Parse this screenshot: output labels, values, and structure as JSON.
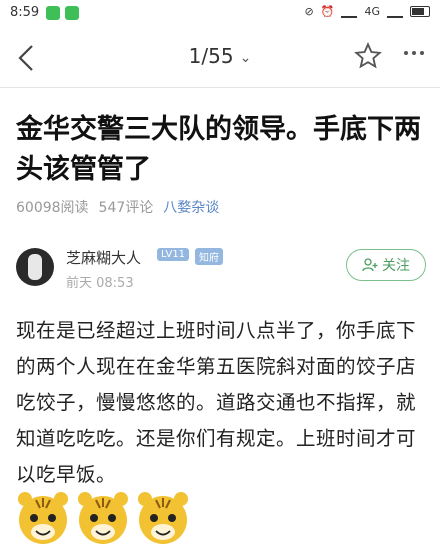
{
  "status_bar": {
    "time": "8:59",
    "network": "4G",
    "app_badge_color": "#3fbf57"
  },
  "nav": {
    "page_indicator": "1/55",
    "icons": [
      "chevron-left-icon",
      "star-icon",
      "more-icon"
    ]
  },
  "post": {
    "title": "金华交警三大队的领导。手底下两头该管管了",
    "views": "60098阅读",
    "comments": "547评论",
    "category": "八婺杂谈"
  },
  "author": {
    "name": "芝麻糊大人",
    "level_badge": "LV11",
    "role_badge": "知府",
    "time": "前天 08:53",
    "follow_label": "关注"
  },
  "content": {
    "body": "现在是已经超过上班时间八点半了，你手底下的两个人现在在金华第五医院斜对面的饺子店吃饺子，慢慢悠悠的。道路交通也不指挥，就知道吃吃吃。还是你们有规定。上班时间才可以吃早饭。",
    "emojis": [
      "tiger-emoji",
      "tiger-emoji",
      "tiger-emoji"
    ]
  },
  "colors": {
    "accent_blue": "#5b86c7",
    "follow_green": "#4b9e62",
    "badge_blue": "#93b7df"
  }
}
